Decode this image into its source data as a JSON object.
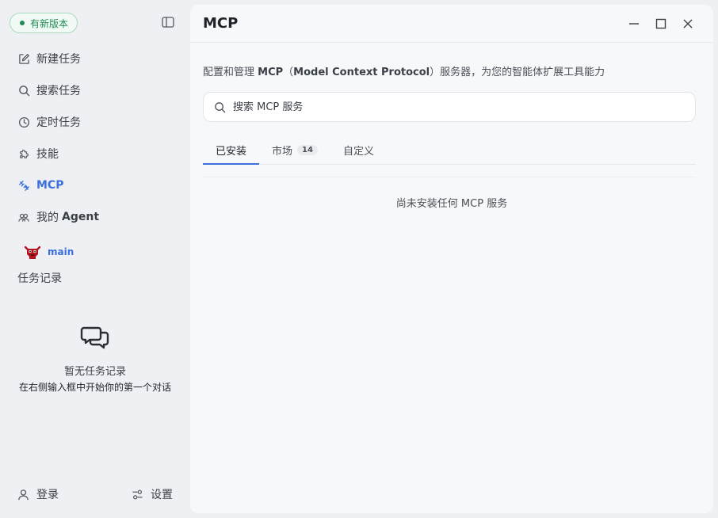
{
  "sidebar": {
    "update_badge": "有新版本",
    "nav": [
      {
        "label": "新建任务",
        "icon": "edit-icon"
      },
      {
        "label": "搜索任务",
        "icon": "search-icon"
      },
      {
        "label": "定时任务",
        "icon": "clock-icon"
      },
      {
        "label": "技能",
        "icon": "puzzle-icon"
      },
      {
        "label": "MCP",
        "icon": "mcp-plug-icon",
        "active": true
      },
      {
        "label_prefix": "我的 ",
        "label_bold": "Agent",
        "icon": "agent-group-icon"
      }
    ],
    "agent": {
      "name": "main",
      "avatar": "red-robot-avatar"
    },
    "history_title": "任务记录",
    "empty_history": {
      "title": "暂无任务记录",
      "hint": "在右侧输入框中开始你的第一个对话"
    },
    "footer": {
      "login_label": "登录",
      "settings_label": "设置"
    }
  },
  "main": {
    "title": "MCP",
    "description": {
      "prefix": "配置和管理 ",
      "mcp": "MCP",
      "paren_open": "（",
      "full_name": "Model Context Protocol",
      "paren_close": "）",
      "suffix": "服务器，为您的智能体扩展工具能力"
    },
    "search": {
      "placeholder": "搜索 MCP 服务"
    },
    "tabs": [
      {
        "label": "已安装",
        "active": true
      },
      {
        "label": "市场",
        "count": "14"
      },
      {
        "label": "自定义"
      }
    ],
    "empty_state": "尚未安装任何 MCP 服务"
  },
  "colors": {
    "accent": "#3a6fdc",
    "update_green": "#1f8a54",
    "background": "#eef0f3",
    "panel": "#f7f8fa"
  }
}
